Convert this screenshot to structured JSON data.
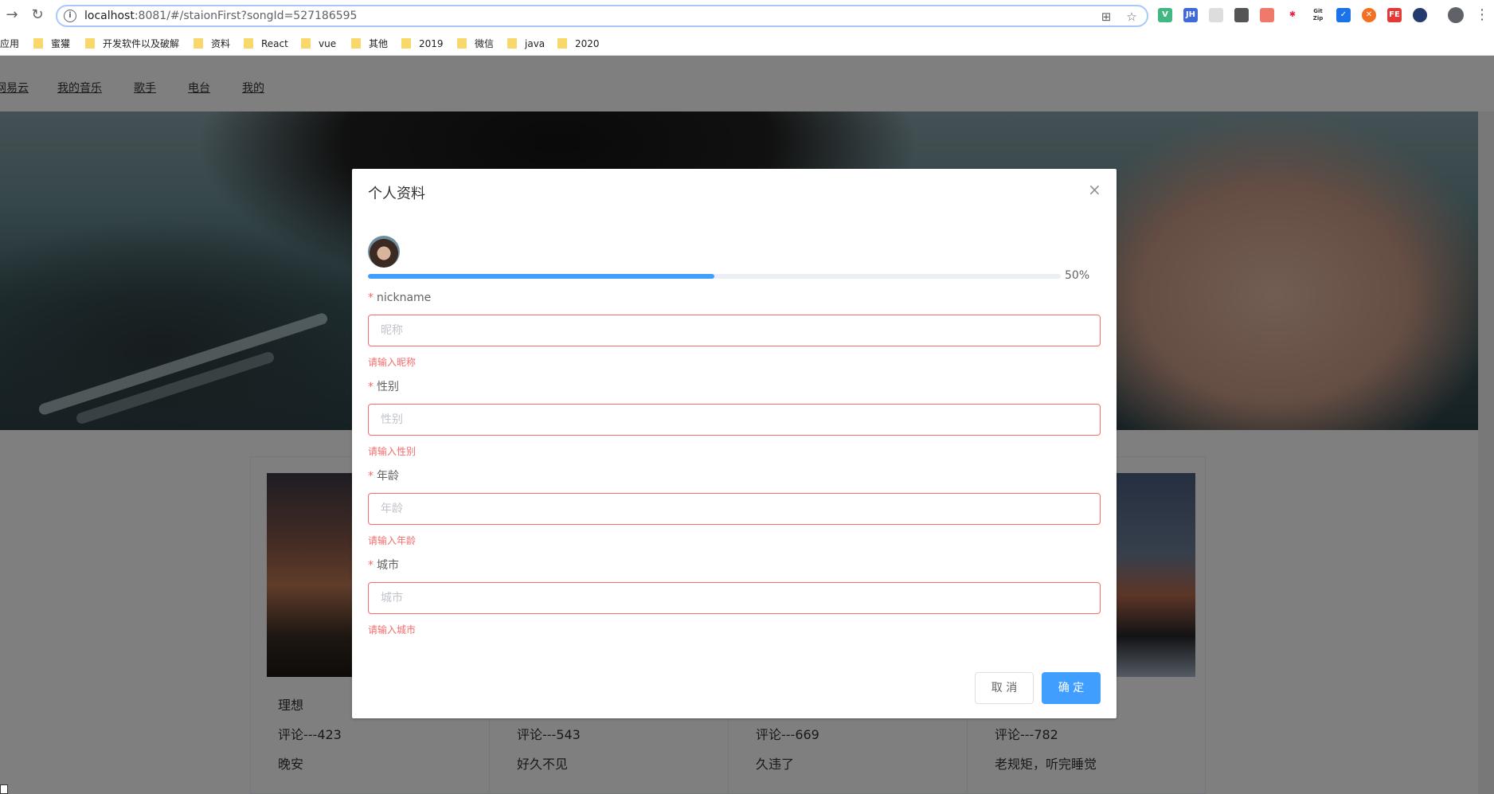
{
  "browser": {
    "url_host": "localhost",
    "url_path": ":8081/#/staionFirst?songId=527186595",
    "bookmarks": [
      "应用",
      "蜜獾",
      "开发软件以及破解",
      "资料",
      "React",
      "vue",
      "其他",
      "2019",
      "微信",
      "java",
      "2020"
    ],
    "extensions": [
      "V",
      "JH",
      "",
      "",
      "",
      "",
      "Git Zip",
      "",
      "",
      "FE",
      ""
    ]
  },
  "site_nav": [
    "网易云",
    "我的音乐",
    "歌手",
    "电台",
    "我的"
  ],
  "cards": [
    {
      "title": "理想",
      "comments": "评论---423",
      "desc": "晚安"
    },
    {
      "title": "",
      "comments": "评论---543",
      "desc": "好久不见"
    },
    {
      "title": "",
      "comments": "评论---669",
      "desc": "久违了"
    },
    {
      "title": "",
      "comments": "评论---782",
      "desc": "老规矩，听完睡觉"
    }
  ],
  "dialog": {
    "title": "个人资料",
    "close": "×",
    "progress": 50,
    "progress_label": "50%",
    "fields": [
      {
        "label": "nickname",
        "placeholder": "昵称",
        "error": "请输入昵称"
      },
      {
        "label": "性别",
        "placeholder": "性别",
        "error": "请输入性别"
      },
      {
        "label": "年龄",
        "placeholder": "年龄",
        "error": "请输入年龄"
      },
      {
        "label": "城市",
        "placeholder": "城市",
        "error": "请输入城市"
      }
    ],
    "cancel": "取 消",
    "confirm": "确 定"
  },
  "colors": {
    "primary": "#409eff",
    "danger": "#f56c6c",
    "mask": "rgba(0,0,0,0.5)"
  }
}
